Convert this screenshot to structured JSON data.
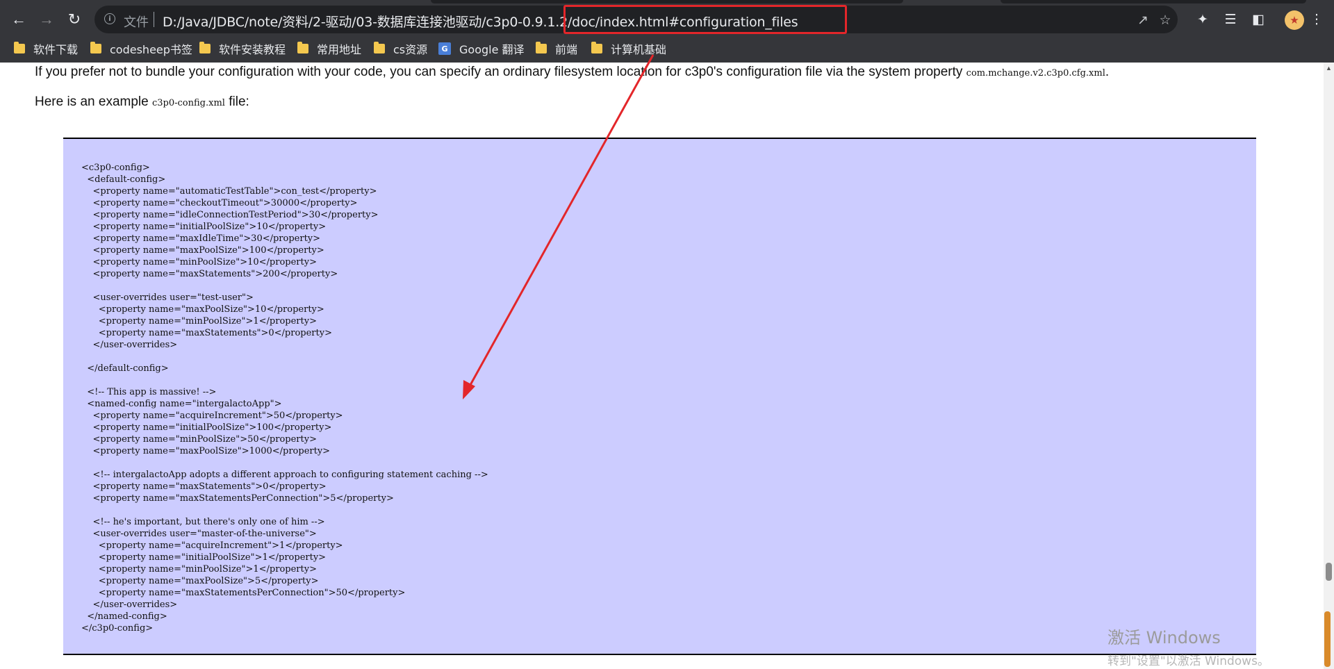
{
  "browser": {
    "scheme_label": "文件",
    "url_visible": "D:/Java/JDBC/note/资料/2-驱动/03-数据库连接池驱动/c3p0-0.9.1.2/doc/index.html#configuration_files",
    "bookmarks": [
      {
        "label": "软件下载",
        "icon": "folder-icon"
      },
      {
        "label": "codesheep书签",
        "icon": "folder-icon"
      },
      {
        "label": "软件安装教程",
        "icon": "folder-icon"
      },
      {
        "label": "常用地址",
        "icon": "folder-icon"
      },
      {
        "label": "cs资源",
        "icon": "folder-icon"
      },
      {
        "label": "Google 翻译",
        "icon": "google-translate-icon"
      },
      {
        "label": "前端",
        "icon": "folder-icon"
      },
      {
        "label": "计算机基础",
        "icon": "folder-icon"
      }
    ],
    "annotation_color": "#e3262a"
  },
  "page": {
    "intro_before": "If you prefer not to bundle your configuration with your code, you can specify an ordinary filesystem location for c3p0's configuration file via the system property ",
    "intro_code": "com.mchange.v2.c3p0.cfg.xml",
    "intro_after": ".",
    "example_before": "Here is an example ",
    "example_code": "c3p0-config.xml",
    "example_after": " file:",
    "code_background": "#ccccff",
    "code_lines": [
      "<c3p0-config>",
      "  <default-config>",
      "    <property name=\"automaticTestTable\">con_test</property>",
      "    <property name=\"checkoutTimeout\">30000</property>",
      "    <property name=\"idleConnectionTestPeriod\">30</property>",
      "    <property name=\"initialPoolSize\">10</property>",
      "    <property name=\"maxIdleTime\">30</property>",
      "    <property name=\"maxPoolSize\">100</property>",
      "    <property name=\"minPoolSize\">10</property>",
      "    <property name=\"maxStatements\">200</property>",
      "",
      "    <user-overrides user=\"test-user\">",
      "      <property name=\"maxPoolSize\">10</property>",
      "      <property name=\"minPoolSize\">1</property>",
      "      <property name=\"maxStatements\">0</property>",
      "    </user-overrides>",
      "",
      "  </default-config>",
      "",
      "  <!-- This app is massive! -->",
      "  <named-config name=\"intergalactoApp\">",
      "    <property name=\"acquireIncrement\">50</property>",
      "    <property name=\"initialPoolSize\">100</property>",
      "    <property name=\"minPoolSize\">50</property>",
      "    <property name=\"maxPoolSize\">1000</property>",
      "",
      "    <!-- intergalactoApp adopts a different approach to configuring statement caching -->",
      "    <property name=\"maxStatements\">0</property>",
      "    <property name=\"maxStatementsPerConnection\">5</property>",
      "",
      "    <!-- he's important, but there's only one of him -->",
      "    <user-overrides user=\"master-of-the-universe\">",
      "      <property name=\"acquireIncrement\">1</property>",
      "      <property name=\"initialPoolSize\">1</property>",
      "      <property name=\"minPoolSize\">1</property>",
      "      <property name=\"maxPoolSize\">5</property>",
      "      <property name=\"maxStatementsPerConnection\">50</property>",
      "    </user-overrides>",
      "  </named-config>",
      "</c3p0-config>"
    ]
  },
  "watermark": {
    "title": "激活 Windows",
    "subtitle": "转到\"设置\"以激活 Windows。"
  }
}
